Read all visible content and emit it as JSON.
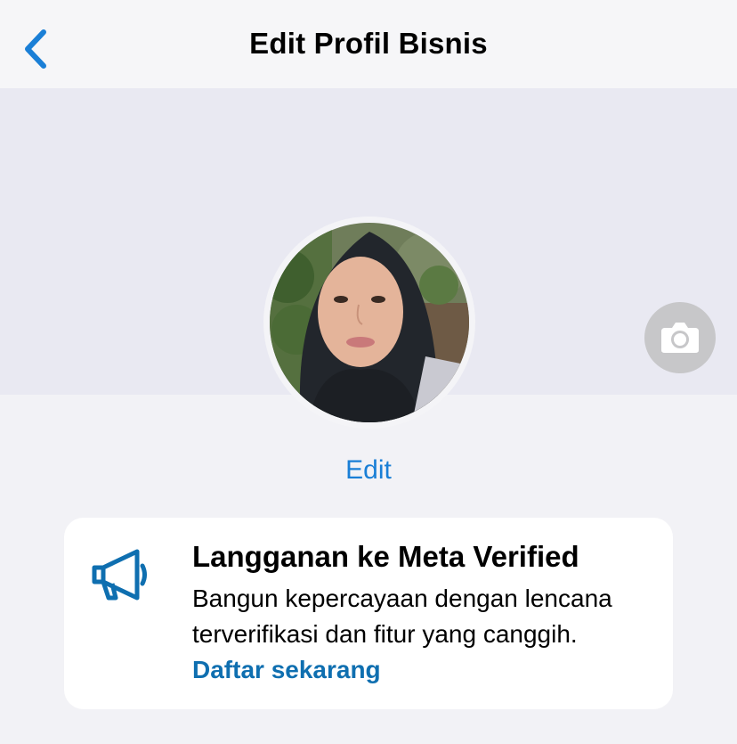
{
  "header": {
    "title": "Edit Profil Bisnis",
    "back_icon": "chevron-left-icon"
  },
  "profile": {
    "edit_label": "Edit",
    "camera_icon": "camera-icon"
  },
  "promo": {
    "icon": "megaphone-icon",
    "title": "Langganan ke Meta Verified",
    "body": "Bangun kepercayaan dengan lencana terverifikasi dan fitur yang canggih.",
    "link_label": "Daftar sekarang"
  },
  "colors": {
    "accent": "#1a7fd6",
    "link": "#0f6fb0",
    "background": "#f2f2f6",
    "cover": "#e9e9f2"
  }
}
